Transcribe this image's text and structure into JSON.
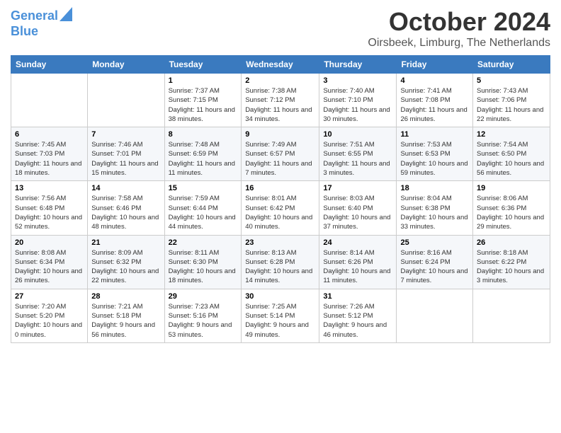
{
  "logo": {
    "line1": "General",
    "line2": "Blue"
  },
  "title": "October 2024",
  "location": "Oirsbeek, Limburg, The Netherlands",
  "weekdays": [
    "Sunday",
    "Monday",
    "Tuesday",
    "Wednesday",
    "Thursday",
    "Friday",
    "Saturday"
  ],
  "weeks": [
    [
      {
        "num": "",
        "sunrise": "",
        "sunset": "",
        "daylight": ""
      },
      {
        "num": "",
        "sunrise": "",
        "sunset": "",
        "daylight": ""
      },
      {
        "num": "1",
        "sunrise": "Sunrise: 7:37 AM",
        "sunset": "Sunset: 7:15 PM",
        "daylight": "Daylight: 11 hours and 38 minutes."
      },
      {
        "num": "2",
        "sunrise": "Sunrise: 7:38 AM",
        "sunset": "Sunset: 7:12 PM",
        "daylight": "Daylight: 11 hours and 34 minutes."
      },
      {
        "num": "3",
        "sunrise": "Sunrise: 7:40 AM",
        "sunset": "Sunset: 7:10 PM",
        "daylight": "Daylight: 11 hours and 30 minutes."
      },
      {
        "num": "4",
        "sunrise": "Sunrise: 7:41 AM",
        "sunset": "Sunset: 7:08 PM",
        "daylight": "Daylight: 11 hours and 26 minutes."
      },
      {
        "num": "5",
        "sunrise": "Sunrise: 7:43 AM",
        "sunset": "Sunset: 7:06 PM",
        "daylight": "Daylight: 11 hours and 22 minutes."
      }
    ],
    [
      {
        "num": "6",
        "sunrise": "Sunrise: 7:45 AM",
        "sunset": "Sunset: 7:03 PM",
        "daylight": "Daylight: 11 hours and 18 minutes."
      },
      {
        "num": "7",
        "sunrise": "Sunrise: 7:46 AM",
        "sunset": "Sunset: 7:01 PM",
        "daylight": "Daylight: 11 hours and 15 minutes."
      },
      {
        "num": "8",
        "sunrise": "Sunrise: 7:48 AM",
        "sunset": "Sunset: 6:59 PM",
        "daylight": "Daylight: 11 hours and 11 minutes."
      },
      {
        "num": "9",
        "sunrise": "Sunrise: 7:49 AM",
        "sunset": "Sunset: 6:57 PM",
        "daylight": "Daylight: 11 hours and 7 minutes."
      },
      {
        "num": "10",
        "sunrise": "Sunrise: 7:51 AM",
        "sunset": "Sunset: 6:55 PM",
        "daylight": "Daylight: 11 hours and 3 minutes."
      },
      {
        "num": "11",
        "sunrise": "Sunrise: 7:53 AM",
        "sunset": "Sunset: 6:53 PM",
        "daylight": "Daylight: 10 hours and 59 minutes."
      },
      {
        "num": "12",
        "sunrise": "Sunrise: 7:54 AM",
        "sunset": "Sunset: 6:50 PM",
        "daylight": "Daylight: 10 hours and 56 minutes."
      }
    ],
    [
      {
        "num": "13",
        "sunrise": "Sunrise: 7:56 AM",
        "sunset": "Sunset: 6:48 PM",
        "daylight": "Daylight: 10 hours and 52 minutes."
      },
      {
        "num": "14",
        "sunrise": "Sunrise: 7:58 AM",
        "sunset": "Sunset: 6:46 PM",
        "daylight": "Daylight: 10 hours and 48 minutes."
      },
      {
        "num": "15",
        "sunrise": "Sunrise: 7:59 AM",
        "sunset": "Sunset: 6:44 PM",
        "daylight": "Daylight: 10 hours and 44 minutes."
      },
      {
        "num": "16",
        "sunrise": "Sunrise: 8:01 AM",
        "sunset": "Sunset: 6:42 PM",
        "daylight": "Daylight: 10 hours and 40 minutes."
      },
      {
        "num": "17",
        "sunrise": "Sunrise: 8:03 AM",
        "sunset": "Sunset: 6:40 PM",
        "daylight": "Daylight: 10 hours and 37 minutes."
      },
      {
        "num": "18",
        "sunrise": "Sunrise: 8:04 AM",
        "sunset": "Sunset: 6:38 PM",
        "daylight": "Daylight: 10 hours and 33 minutes."
      },
      {
        "num": "19",
        "sunrise": "Sunrise: 8:06 AM",
        "sunset": "Sunset: 6:36 PM",
        "daylight": "Daylight: 10 hours and 29 minutes."
      }
    ],
    [
      {
        "num": "20",
        "sunrise": "Sunrise: 8:08 AM",
        "sunset": "Sunset: 6:34 PM",
        "daylight": "Daylight: 10 hours and 26 minutes."
      },
      {
        "num": "21",
        "sunrise": "Sunrise: 8:09 AM",
        "sunset": "Sunset: 6:32 PM",
        "daylight": "Daylight: 10 hours and 22 minutes."
      },
      {
        "num": "22",
        "sunrise": "Sunrise: 8:11 AM",
        "sunset": "Sunset: 6:30 PM",
        "daylight": "Daylight: 10 hours and 18 minutes."
      },
      {
        "num": "23",
        "sunrise": "Sunrise: 8:13 AM",
        "sunset": "Sunset: 6:28 PM",
        "daylight": "Daylight: 10 hours and 14 minutes."
      },
      {
        "num": "24",
        "sunrise": "Sunrise: 8:14 AM",
        "sunset": "Sunset: 6:26 PM",
        "daylight": "Daylight: 10 hours and 11 minutes."
      },
      {
        "num": "25",
        "sunrise": "Sunrise: 8:16 AM",
        "sunset": "Sunset: 6:24 PM",
        "daylight": "Daylight: 10 hours and 7 minutes."
      },
      {
        "num": "26",
        "sunrise": "Sunrise: 8:18 AM",
        "sunset": "Sunset: 6:22 PM",
        "daylight": "Daylight: 10 hours and 3 minutes."
      }
    ],
    [
      {
        "num": "27",
        "sunrise": "Sunrise: 7:20 AM",
        "sunset": "Sunset: 5:20 PM",
        "daylight": "Daylight: 10 hours and 0 minutes."
      },
      {
        "num": "28",
        "sunrise": "Sunrise: 7:21 AM",
        "sunset": "Sunset: 5:18 PM",
        "daylight": "Daylight: 9 hours and 56 minutes."
      },
      {
        "num": "29",
        "sunrise": "Sunrise: 7:23 AM",
        "sunset": "Sunset: 5:16 PM",
        "daylight": "Daylight: 9 hours and 53 minutes."
      },
      {
        "num": "30",
        "sunrise": "Sunrise: 7:25 AM",
        "sunset": "Sunset: 5:14 PM",
        "daylight": "Daylight: 9 hours and 49 minutes."
      },
      {
        "num": "31",
        "sunrise": "Sunrise: 7:26 AM",
        "sunset": "Sunset: 5:12 PM",
        "daylight": "Daylight: 9 hours and 46 minutes."
      },
      {
        "num": "",
        "sunrise": "",
        "sunset": "",
        "daylight": ""
      },
      {
        "num": "",
        "sunrise": "",
        "sunset": "",
        "daylight": ""
      }
    ]
  ]
}
